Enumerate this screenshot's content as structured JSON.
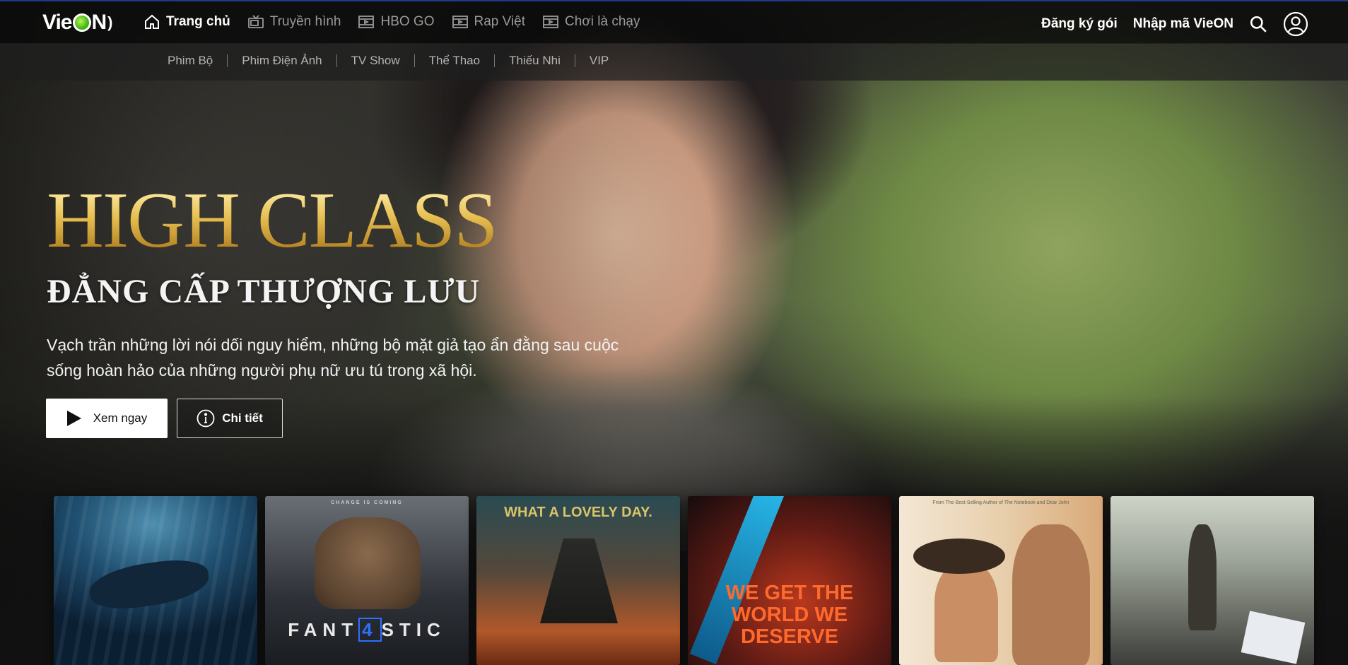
{
  "brand": {
    "logo_left": "Vie",
    "logo_right": "N"
  },
  "nav": {
    "items": [
      {
        "label": "Trang chủ",
        "icon": "home-icon",
        "active": true
      },
      {
        "label": "Truyền hình",
        "icon": "tv-icon",
        "active": false
      },
      {
        "label": "HBO GO",
        "icon": "play-box-icon",
        "active": false
      },
      {
        "label": "Rap Việt",
        "icon": "play-box-icon",
        "active": false
      },
      {
        "label": "Chơi là chạy",
        "icon": "play-box-icon",
        "active": false
      }
    ],
    "register_label": "Đăng ký gói",
    "code_label": "Nhập mã VieON"
  },
  "subnav": {
    "items": [
      "Phim Bộ",
      "Phim Điện Ảnh",
      "TV Show",
      "Thể Thao",
      "Thiếu Nhi",
      "VIP"
    ]
  },
  "hero": {
    "title_en": "HIGH CLASS",
    "title_vn": "ĐẲNG CẤP THƯỢNG LƯU",
    "description": "Vạch trần những lời nói dối nguy hiểm, những bộ mặt giả tạo ẩn đằng sau cuộc sống hoàn hảo của những người phụ nữ ưu tú trong xã hội.",
    "play_label": "Xem ngay",
    "info_label": "Chi tiết"
  },
  "posters": {
    "p2_top": "CHANGE IS COMING",
    "p2_title_a": "FANT",
    "p2_title_4": "4",
    "p2_title_b": "STIC",
    "p3_title": "WHAT A LOVELY DAY.",
    "p4_title": "WE GET THE WORLD WE DESERVE",
    "p5_top": "From The Best-Selling Author of The Notebook and Dear John"
  },
  "colors": {
    "accent_blue": "#1f3a8a",
    "title_gold": "#e3b84a",
    "logo_green": "#41b814"
  }
}
